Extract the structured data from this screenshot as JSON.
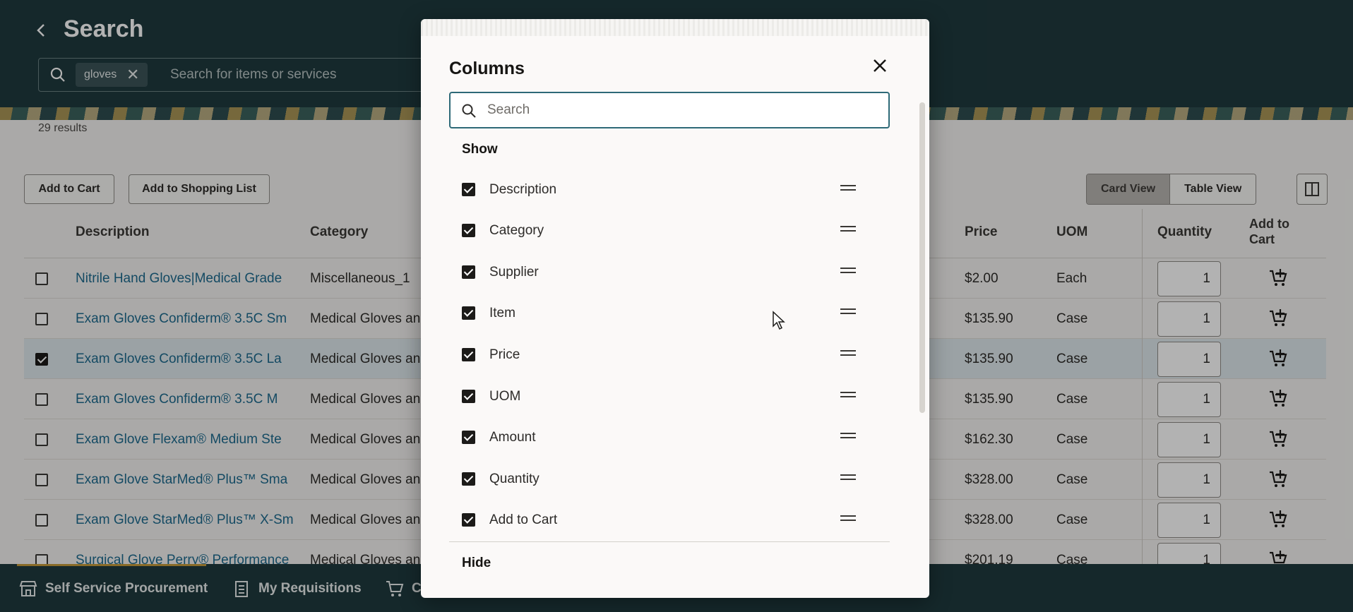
{
  "header": {
    "title": "Search",
    "search_chip": "gloves",
    "search_placeholder": "Search for items or services"
  },
  "results": {
    "count_text": "29 results"
  },
  "toolbar": {
    "add_to_cart": "Add to Cart",
    "add_to_shopping_list": "Add to Shopping List",
    "card_view": "Card View",
    "table_view": "Table View"
  },
  "table": {
    "headers": {
      "description": "Description",
      "category": "Category",
      "price": "Price",
      "uom": "UOM",
      "quantity": "Quantity",
      "add_to_cart": "Add to Cart"
    },
    "rows": [
      {
        "description": "Nitrile Hand Gloves|Medical Grade",
        "category": "Miscellaneous_1",
        "price": "$2.00",
        "uom": "Each",
        "quantity": "1",
        "checked": false
      },
      {
        "description": "Exam Gloves Confiderm® 3.5C Sm",
        "category": "Medical Gloves an",
        "price": "$135.90",
        "uom": "Case",
        "quantity": "1",
        "checked": false
      },
      {
        "description": "Exam Gloves Confiderm® 3.5C La",
        "category": "Medical Gloves an",
        "price": "$135.90",
        "uom": "Case",
        "quantity": "1",
        "checked": true
      },
      {
        "description": "Exam Gloves Confiderm® 3.5C M",
        "category": "Medical Gloves an",
        "price": "$135.90",
        "uom": "Case",
        "quantity": "1",
        "checked": false
      },
      {
        "description": "Exam Glove Flexam® Medium Ste",
        "category": "Medical Gloves an",
        "price": "$162.30",
        "uom": "Case",
        "quantity": "1",
        "checked": false
      },
      {
        "description": "Exam Glove StarMed® Plus™ Sma",
        "category": "Medical Gloves an",
        "price": "$328.00",
        "uom": "Case",
        "quantity": "1",
        "checked": false
      },
      {
        "description": "Exam Glove StarMed® Plus™ X-Sm",
        "category": "Medical Gloves an",
        "price": "$328.00",
        "uom": "Case",
        "quantity": "1",
        "checked": false
      },
      {
        "description": "Surgical Glove Perry® Performance",
        "category": "Medical Gloves an",
        "price": "$201.19",
        "uom": "Case",
        "quantity": "1",
        "checked": false
      }
    ]
  },
  "bottom_nav": {
    "items": [
      "Self Service Procurement",
      "My Requisitions",
      "C"
    ]
  },
  "dialog": {
    "title": "Columns",
    "search_placeholder": "Search",
    "show_label": "Show",
    "hide_label": "Hide",
    "show_items": [
      "Description",
      "Category",
      "Supplier",
      "Item",
      "Price",
      "UOM",
      "Amount",
      "Quantity",
      "Add to Cart"
    ]
  }
}
